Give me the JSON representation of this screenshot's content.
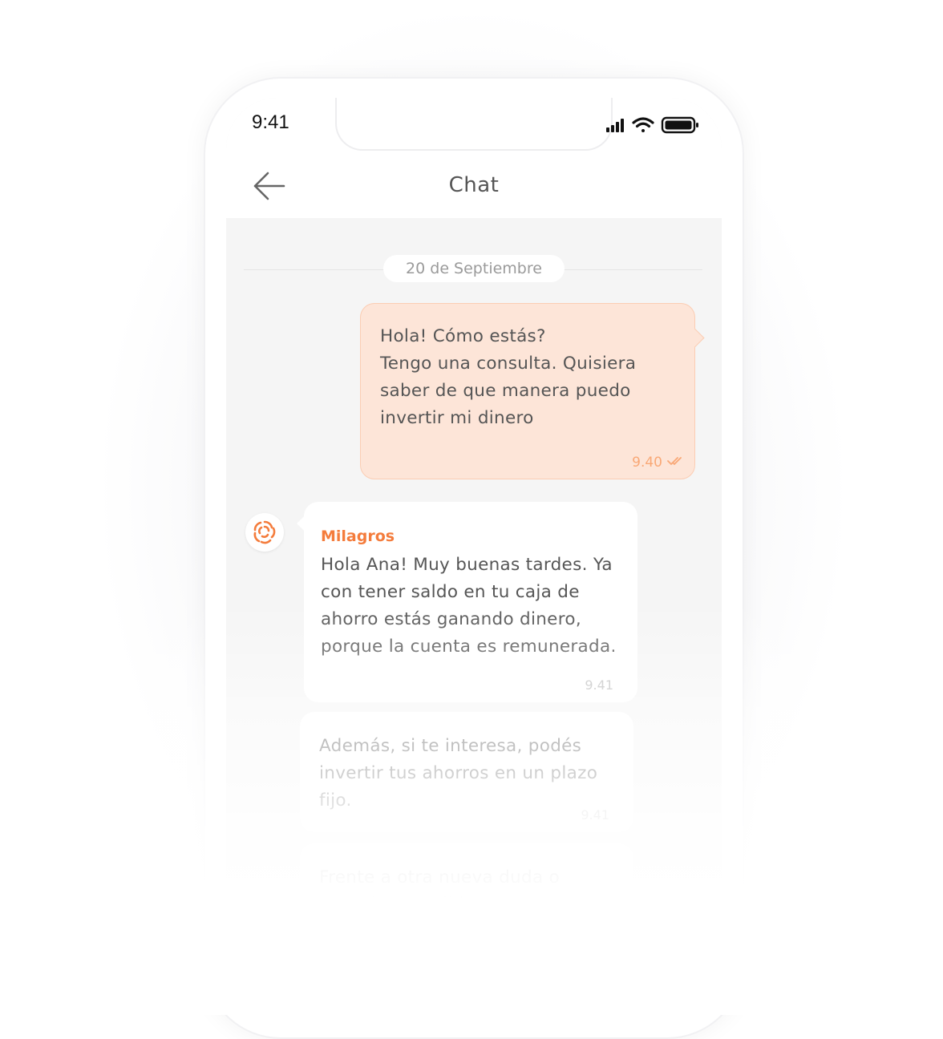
{
  "status_bar": {
    "time": "9:41",
    "icons": [
      "signal-icon",
      "wifi-icon",
      "battery-icon"
    ]
  },
  "header": {
    "title": "Chat",
    "back_icon": "arrow-left-icon"
  },
  "date_separator": "20 de Septiembre",
  "messages": [
    {
      "direction": "outgoing",
      "text": "Hola! Cómo estás?\nTengo una consulta. Quisiera saber de que manera puedo invertir mi dinero",
      "time": "9.40",
      "status_icon": "double-check-icon"
    },
    {
      "direction": "incoming",
      "sender": "Milagros",
      "text": "Hola Ana! Muy buenas tardes. Ya con tener saldo en tu caja de ahorro estás ganando dinero, porque la cuenta es remunerada.",
      "time": "9.41"
    },
    {
      "direction": "incoming",
      "text": "Además, si te interesa, podés invertir tus ahorros en un plazo fijo.",
      "time": "9.41"
    },
    {
      "direction": "incoming",
      "text": "Frente a otra nueva duda o consulta, escribinos."
    }
  ],
  "colors": {
    "accent": "#f47c3c",
    "outgoing_bubble": "#fde5d8",
    "chat_background": "#f5f5f5"
  }
}
